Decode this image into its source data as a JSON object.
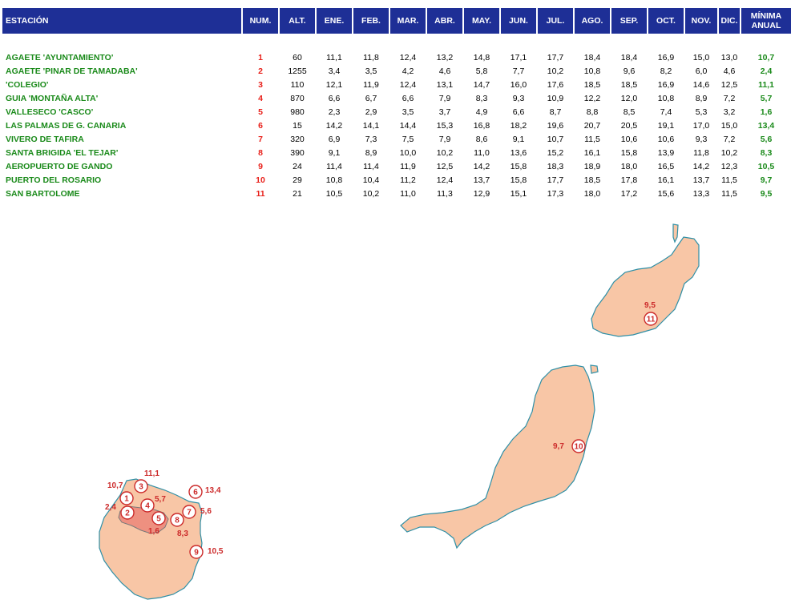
{
  "table": {
    "headers": {
      "estacion": "ESTACIÓN",
      "num": "NUM.",
      "alt": "ALT.",
      "months": [
        "ENE.",
        "FEB.",
        "MAR.",
        "ABR.",
        "MAY.",
        "JUN.",
        "JUL.",
        "AGO.",
        "SEP.",
        "OCT.",
        "NOV.",
        "DIC."
      ],
      "minima_l1": "MÍNIMA",
      "minima_l2": "ANUAL"
    },
    "rows": [
      {
        "name": "AGAETE 'AYUNTAMIENTO'",
        "num": "1",
        "alt": "60",
        "months": [
          "11,1",
          "11,8",
          "12,4",
          "13,2",
          "14,8",
          "17,1",
          "17,7",
          "18,4",
          "18,4",
          "16,9",
          "15,0",
          "13,0"
        ],
        "min": "10,7"
      },
      {
        "name": "AGAETE 'PINAR DE TAMADABA'",
        "num": "2",
        "alt": "1255",
        "months": [
          "3,4",
          "3,5",
          "4,2",
          "4,6",
          "5,8",
          "7,7",
          "10,2",
          "10,8",
          "9,6",
          "8,2",
          "6,0",
          "4,6"
        ],
        "min": "2,4"
      },
      {
        "name": "'COLEGIO'",
        "num": "3",
        "alt": "110",
        "months": [
          "12,1",
          "11,9",
          "12,4",
          "13,1",
          "14,7",
          "16,0",
          "17,6",
          "18,5",
          "18,5",
          "16,9",
          "14,6",
          "12,5"
        ],
        "min": "11,1"
      },
      {
        "name": "GUIA 'MONTAÑA ALTA'",
        "num": "4",
        "alt": "870",
        "months": [
          "6,6",
          "6,7",
          "6,6",
          "7,9",
          "8,3",
          "9,3",
          "10,9",
          "12,2",
          "12,0",
          "10,8",
          "8,9",
          "7,2"
        ],
        "min": "5,7"
      },
      {
        "name": "VALLESECO 'CASCO'",
        "num": "5",
        "alt": "980",
        "months": [
          "2,3",
          "2,9",
          "3,5",
          "3,7",
          "4,9",
          "6,6",
          "8,7",
          "8,8",
          "8,5",
          "7,4",
          "5,3",
          "3,2"
        ],
        "min": "1,6"
      },
      {
        "name": "LAS PALMAS DE G. CANARIA",
        "num": "6",
        "alt": "15",
        "months": [
          "14,2",
          "14,1",
          "14,4",
          "15,3",
          "16,8",
          "18,2",
          "19,6",
          "20,7",
          "20,5",
          "19,1",
          "17,0",
          "15,0"
        ],
        "min": "13,4"
      },
      {
        "name": "VIVERO DE TAFIRA",
        "num": "7",
        "alt": "320",
        "months": [
          "6,9",
          "7,3",
          "7,5",
          "7,9",
          "8,6",
          "9,1",
          "10,7",
          "11,5",
          "10,6",
          "10,6",
          "9,3",
          "7,2"
        ],
        "min": "5,6"
      },
      {
        "name": "SANTA BRIGIDA 'EL TEJAR'",
        "num": "8",
        "alt": "390",
        "months": [
          "9,1",
          "8,9",
          "10,0",
          "10,2",
          "11,0",
          "13,6",
          "15,2",
          "16,1",
          "15,8",
          "13,9",
          "11,8",
          "10,2"
        ],
        "min": "8,3"
      },
      {
        "name": "AEROPUERTO DE GANDO",
        "num": "9",
        "alt": "24",
        "months": [
          "11,4",
          "11,4",
          "11,9",
          "12,5",
          "14,2",
          "15,8",
          "18,3",
          "18,9",
          "18,0",
          "16,5",
          "14,2",
          "12,3"
        ],
        "min": "10,5"
      },
      {
        "name": "PUERTO DEL ROSARIO",
        "num": "10",
        "alt": "29",
        "months": [
          "10,8",
          "10,4",
          "11,2",
          "12,4",
          "13,7",
          "15,8",
          "17,7",
          "18,5",
          "17,8",
          "16,1",
          "13,7",
          "11,5"
        ],
        "min": "9,7"
      },
      {
        "name": "SAN BARTOLOME",
        "num": "11",
        "alt": "21",
        "months": [
          "10,5",
          "10,2",
          "11,0",
          "11,3",
          "12,9",
          "15,1",
          "17,3",
          "18,0",
          "17,2",
          "15,6",
          "13,3",
          "11,5"
        ],
        "min": "9,5"
      }
    ]
  },
  "map": {
    "colors": {
      "land": "#f8c6a6",
      "coast": "#2e8fa6",
      "mountain": "#ee9080",
      "marker": "#cc2a2a"
    },
    "markers": [
      {
        "num": "1",
        "value": "10,7"
      },
      {
        "num": "2",
        "value": "2,4"
      },
      {
        "num": "3",
        "value": "11,1"
      },
      {
        "num": "4",
        "value": "5,7"
      },
      {
        "num": "5",
        "value": "1,6"
      },
      {
        "num": "6",
        "value": "13,4"
      },
      {
        "num": "7",
        "value": "5,6"
      },
      {
        "num": "8",
        "value": "8,3"
      },
      {
        "num": "9",
        "value": "10,5"
      },
      {
        "num": "10",
        "value": "9,7"
      },
      {
        "num": "11",
        "value": "9,5"
      }
    ]
  }
}
